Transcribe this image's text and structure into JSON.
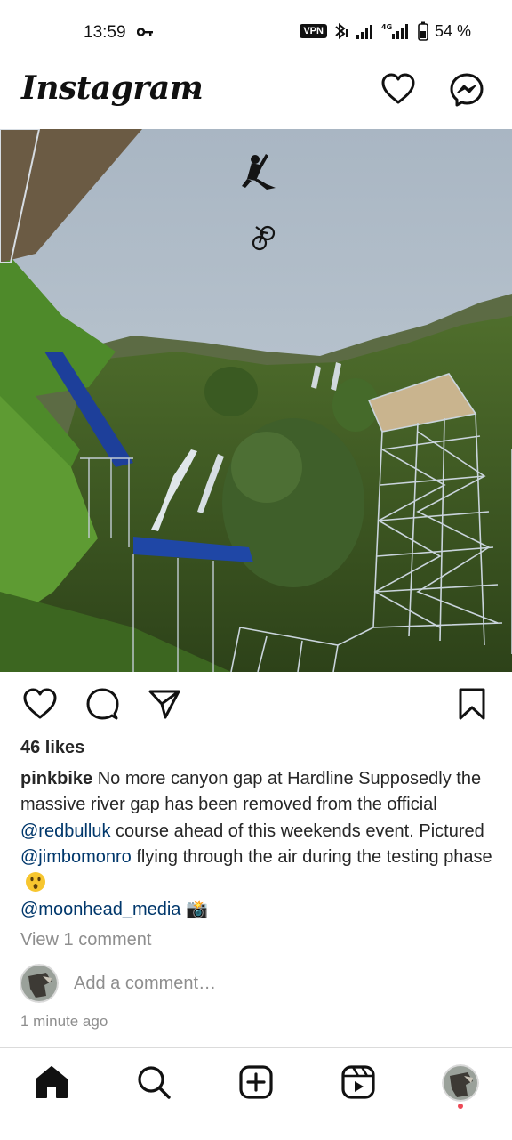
{
  "status_bar": {
    "time": "13:59",
    "vpn_label": "VPN",
    "battery": "54 %",
    "icons": [
      "key-icon",
      "bluetooth-icon",
      "signal-icon",
      "4g-signal-icon",
      "battery-icon"
    ]
  },
  "header": {
    "logo_text": "Instagram",
    "icons": [
      "chevron-down-icon",
      "heart-icon",
      "messenger-icon"
    ]
  },
  "post": {
    "image_description_icons": [
      "photo"
    ],
    "likes": "46 likes",
    "caption": {
      "username": "pinkbike",
      "text_1": " No more canyon gap at Hardline Supposedly the massive river gap has been removed from the official ",
      "mention_1": "@redbulluk",
      "text_2": " course ahead of this weekends event. Pictured ",
      "mention_2": "@jimbomonro",
      "text_3": " flying through the air during the testing phase ",
      "mention_3": "@moonhead_media",
      "emoji_2": "📸"
    },
    "view_comments": "View 1 comment",
    "add_comment_placeholder": "Add a comment…",
    "time_ago": "1 minute ago"
  },
  "bottom_nav": {
    "items": [
      "home-icon",
      "search-icon",
      "create-icon",
      "reels-icon",
      "profile-avatar"
    ]
  },
  "colors": {
    "mention": "#00376b",
    "muted": "#8e8e8e",
    "text": "#262626",
    "notification_dot": "#ed4956"
  }
}
